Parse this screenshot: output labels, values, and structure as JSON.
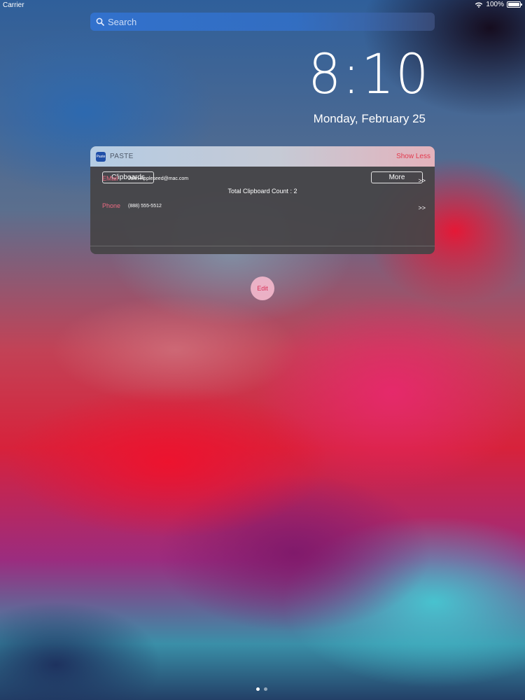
{
  "status_bar": {
    "carrier": "Carrier",
    "battery": "100%",
    "wifi_icon": "wifi-icon",
    "battery_icon": "battery-icon"
  },
  "search": {
    "placeholder": "Search",
    "icon": "search-icon"
  },
  "clock": {
    "time": "8:10",
    "date": "Monday, February 25"
  },
  "widget": {
    "app_icon": "paste-app-icon",
    "app_icon_text": "Paste",
    "app_name": "PASTE",
    "show_less_label": "Show Less",
    "clipboards_label": "Clipboards",
    "more_label": "More",
    "total_count": "Total Clipboard Count : 2",
    "rows": [
      {
        "label": "EMail",
        "value": "John-Appleseed@mac.com",
        "arrow": ">>"
      },
      {
        "label": "Phone",
        "value": "(888) 555-5512",
        "arrow": ">>"
      }
    ],
    "colors": {
      "accent": "#e23a4e",
      "label": "#ec6b82"
    }
  },
  "edit_label": "Edit",
  "page_indicator": {
    "count": 2,
    "current": 1
  }
}
